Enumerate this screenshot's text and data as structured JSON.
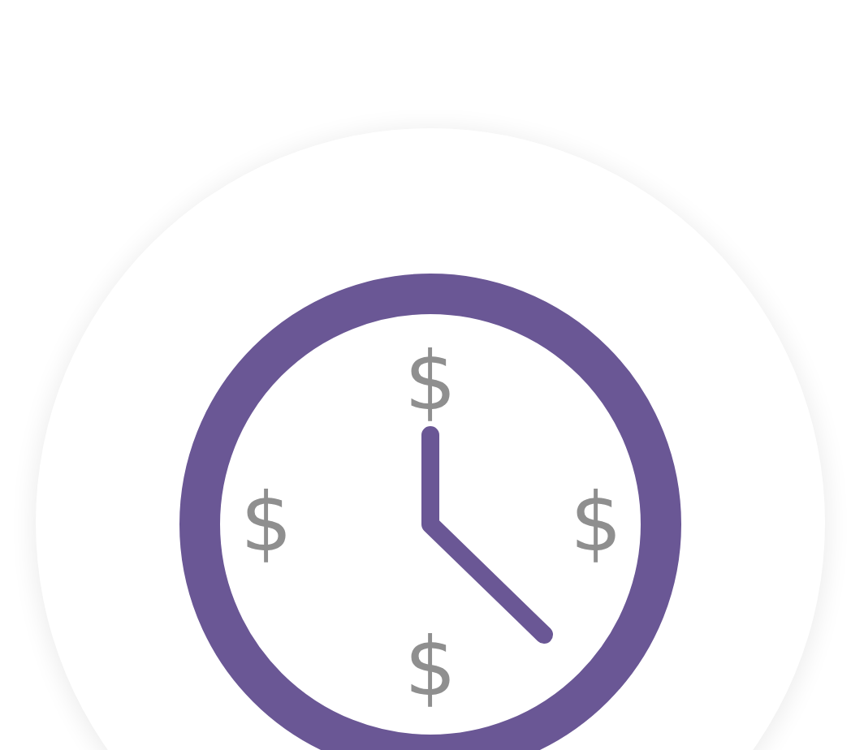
{
  "illustration": {
    "symbols": [
      "$",
      "$",
      "$",
      "$"
    ]
  }
}
